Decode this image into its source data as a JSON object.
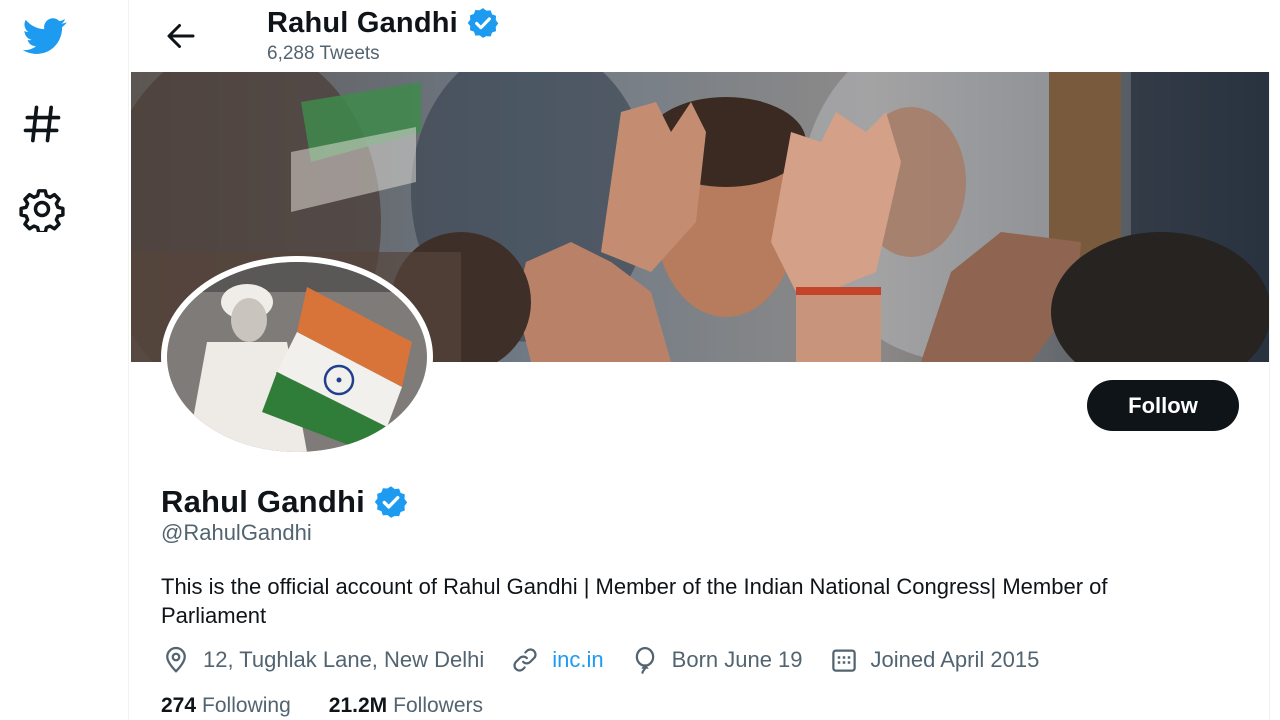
{
  "nav": {
    "icons": [
      "twitter-bird-icon",
      "hashtag-icon",
      "settings-gear-icon"
    ]
  },
  "header": {
    "name": "Rahul Gandhi",
    "tweet_count": "6,288 Tweets"
  },
  "profile": {
    "name": "Rahul Gandhi",
    "handle": "@RahulGandhi",
    "verified": true,
    "follow_label": "Follow",
    "bio": "This is the official account of Rahul Gandhi | Member of the Indian National Congress| Member of Parliament",
    "location": "12, Tughlak Lane, New Delhi",
    "website": "inc.in",
    "birthday": "Born June 19",
    "joined": "Joined April 2015",
    "following_count": "274",
    "following_label": "Following",
    "followers_count": "21.2M",
    "followers_label": "Followers"
  },
  "colors": {
    "accent": "#1d9bf0",
    "text": "#0f1419",
    "secondary_text": "#536471",
    "button_bg": "#0f1419"
  }
}
